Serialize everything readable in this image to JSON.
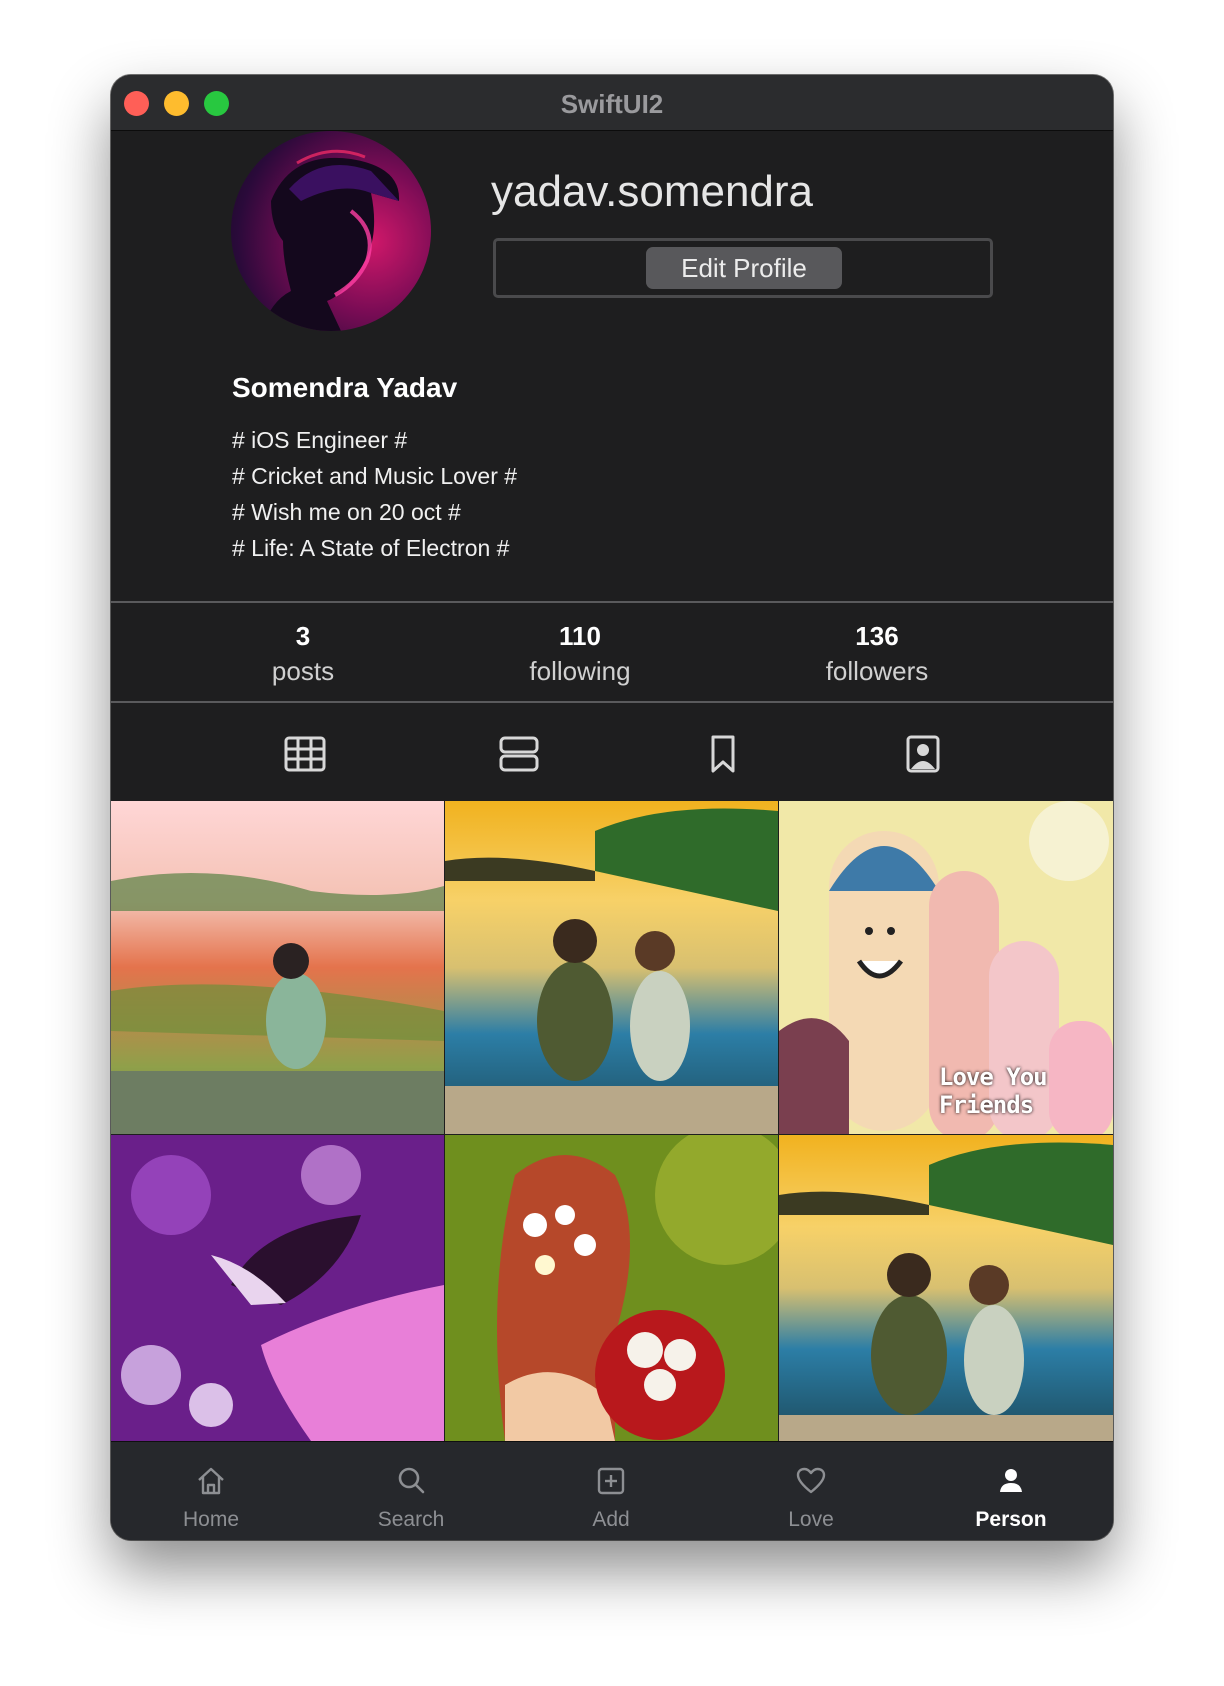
{
  "window": {
    "title": "SwiftUI2"
  },
  "profile": {
    "username": "yadav.somendra",
    "edit_label": "Edit Profile",
    "full_name": "Somendra Yadav",
    "bio": [
      "# iOS Engineer #",
      "# Cricket and Music Lover #",
      "# Wish me on 20 oct #",
      "# Life: A State of Electron #"
    ]
  },
  "stats": [
    {
      "number": "3",
      "label": "posts"
    },
    {
      "number": "110",
      "label": "following"
    },
    {
      "number": "136",
      "label": "followers"
    }
  ],
  "view_tabs": [
    "grid-icon",
    "list-icon",
    "bookmark-icon",
    "tagged-person-icon"
  ],
  "posts": [
    {
      "name": "girl-in-field-photo"
    },
    {
      "name": "kids-by-lake-photo"
    },
    {
      "name": "fingers-friends-photo",
      "caption": "Love You Friends"
    },
    {
      "name": "butterfly-on-hand-photo"
    },
    {
      "name": "bride-with-roses-photo"
    },
    {
      "name": "kids-by-lake-photo-2"
    }
  ],
  "tabbar": [
    {
      "label": "Home",
      "icon": "house-icon"
    },
    {
      "label": "Search",
      "icon": "magnifier-icon"
    },
    {
      "label": "Add",
      "icon": "plus-square-icon"
    },
    {
      "label": "Love",
      "icon": "heart-icon"
    },
    {
      "label": "Person",
      "icon": "person-icon",
      "active": true
    }
  ],
  "colors": {
    "window_bg": "#1e1e1f",
    "tabbar_bg": "#26282c",
    "close": "#ff5f57",
    "minimize": "#febc2e",
    "maximize": "#28c840"
  }
}
